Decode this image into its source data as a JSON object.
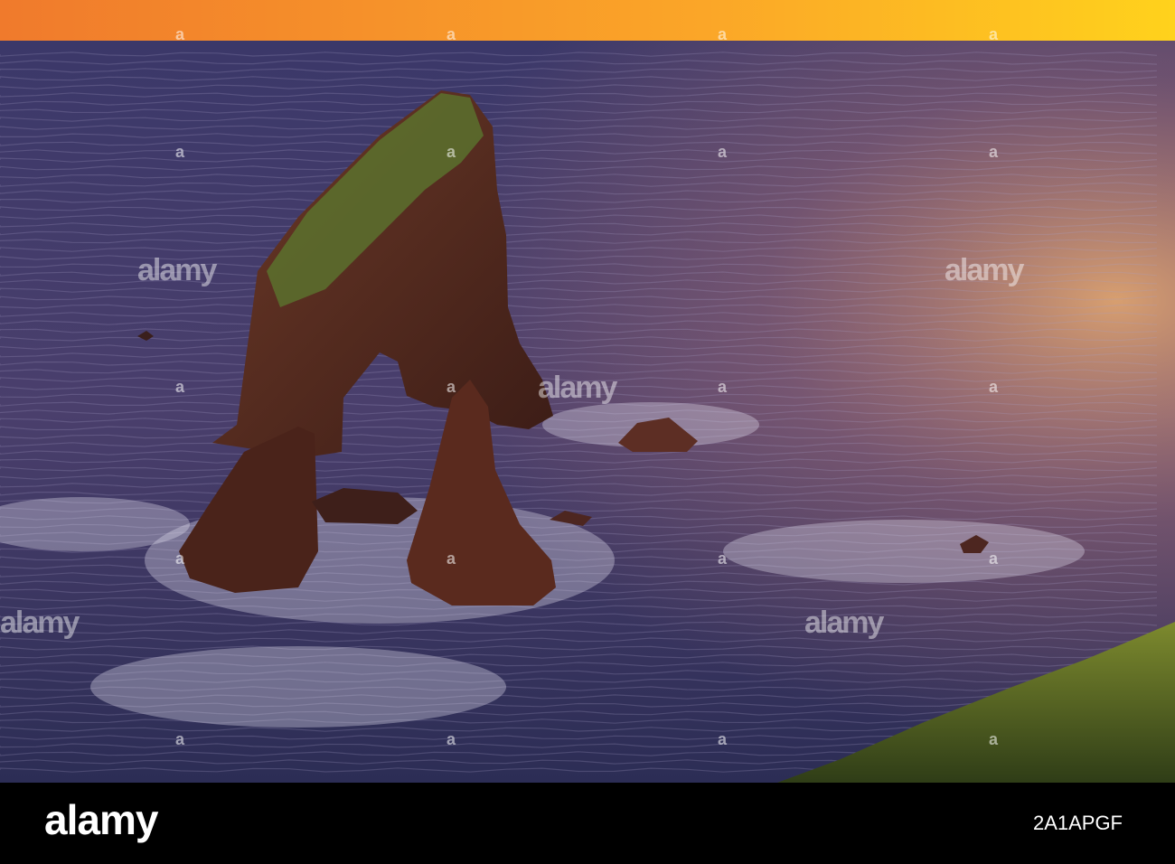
{
  "photo": {
    "subject": "",
    "colors": {
      "sky_top": "#f0832a",
      "sky_horizon": "#ffc21a",
      "sea_far": "#3d3a6e",
      "sea_near": "#2e2f5c",
      "sea_glow": "#d79a6a",
      "rock": "#5a2e22",
      "grass": "#4a6a2a"
    }
  },
  "watermark": {
    "small_mark": "a",
    "big_mark": "alamy"
  },
  "footer": {
    "logo": "alamy",
    "image_id": "2A1APGF"
  }
}
